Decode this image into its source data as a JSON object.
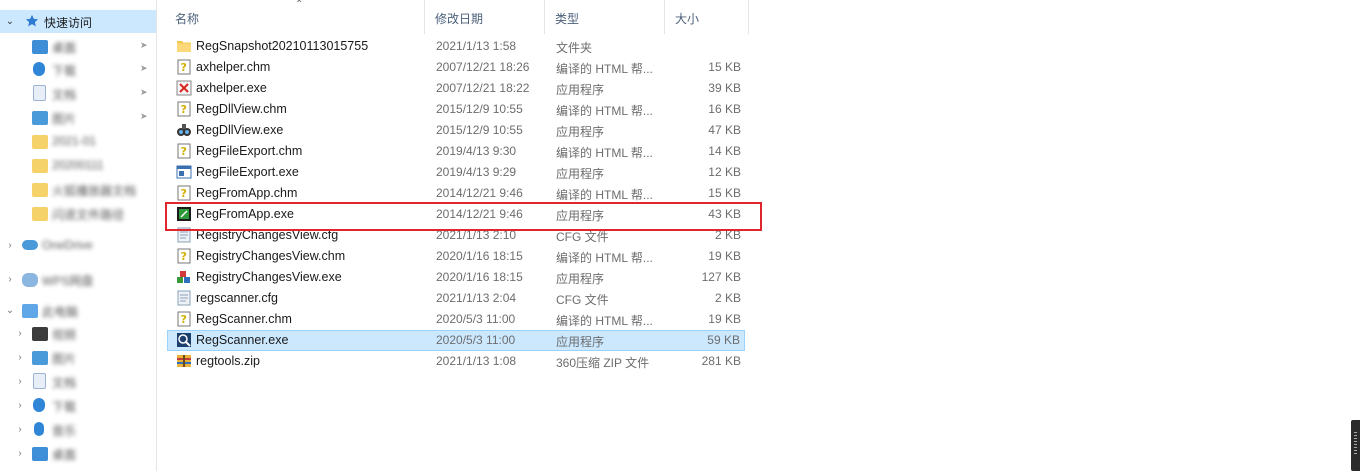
{
  "sidebar": {
    "quick_access_label": "快速访问",
    "quick_items": [
      "桌面",
      "下载",
      "文档",
      "图片",
      "2021-01",
      "20200111",
      "火狐播放器文档",
      "闪退文件路径"
    ],
    "onedrive_label": "OneDrive",
    "wps_label": "WPS网盘",
    "this_pc_label": "此电脑",
    "pc_items": [
      "视频",
      "图片",
      "文档",
      "下载",
      "音乐",
      "桌面"
    ]
  },
  "columns": {
    "name": "名称",
    "date": "修改日期",
    "type": "类型",
    "size": "大小"
  },
  "files": [
    {
      "name": "RegSnapshot20210113015755",
      "date": "2021/1/13 1:58",
      "type": "文件夹",
      "size": "",
      "icon": "folder-icon"
    },
    {
      "name": "axhelper.chm",
      "date": "2007/12/21 18:26",
      "type": "编译的 HTML 帮...",
      "size": "15 KB",
      "icon": "chm-help-icon"
    },
    {
      "name": "axhelper.exe",
      "date": "2007/12/21 18:22",
      "type": "应用程序",
      "size": "39 KB",
      "icon": "app-x-icon"
    },
    {
      "name": "RegDllView.chm",
      "date": "2015/12/9 10:55",
      "type": "编译的 HTML 帮...",
      "size": "16 KB",
      "icon": "chm-help-icon"
    },
    {
      "name": "RegDllView.exe",
      "date": "2015/12/9 10:55",
      "type": "应用程序",
      "size": "47 KB",
      "icon": "app-binoculars-icon"
    },
    {
      "name": "RegFileExport.chm",
      "date": "2019/4/13 9:30",
      "type": "编译的 HTML 帮...",
      "size": "14 KB",
      "icon": "chm-help-icon"
    },
    {
      "name": "RegFileExport.exe",
      "date": "2019/4/13 9:29",
      "type": "应用程序",
      "size": "12 KB",
      "icon": "app-window-icon"
    },
    {
      "name": "RegFromApp.chm",
      "date": "2014/12/21 9:46",
      "type": "编译的 HTML 帮...",
      "size": "15 KB",
      "icon": "chm-help-icon"
    },
    {
      "name": "RegFromApp.exe",
      "date": "2014/12/21 9:46",
      "type": "应用程序",
      "size": "43 KB",
      "icon": "app-green-icon"
    },
    {
      "name": "RegistryChangesView.cfg",
      "date": "2021/1/13 2:10",
      "type": "CFG 文件",
      "size": "2 KB",
      "icon": "cfg-file-icon"
    },
    {
      "name": "RegistryChangesView.chm",
      "date": "2020/1/16 18:15",
      "type": "编译的 HTML 帮...",
      "size": "19 KB",
      "icon": "chm-help-icon"
    },
    {
      "name": "RegistryChangesView.exe",
      "date": "2020/1/16 18:15",
      "type": "应用程序",
      "size": "127 KB",
      "icon": "app-cubes-icon"
    },
    {
      "name": "regscanner.cfg",
      "date": "2021/1/13 2:04",
      "type": "CFG 文件",
      "size": "2 KB",
      "icon": "cfg-file-icon"
    },
    {
      "name": "RegScanner.chm",
      "date": "2020/5/3 11:00",
      "type": "编译的 HTML 帮...",
      "size": "19 KB",
      "icon": "chm-help-icon"
    },
    {
      "name": "RegScanner.exe",
      "date": "2020/5/3 11:00",
      "type": "应用程序",
      "size": "59 KB",
      "icon": "app-scanner-icon"
    },
    {
      "name": "regtools.zip",
      "date": "2021/1/13 1:08",
      "type": "360压缩 ZIP 文件",
      "size": "281 KB",
      "icon": "zip-archive-icon"
    }
  ],
  "selected_file": "RegScanner.exe",
  "highlighted_file": "RegFromApp.exe",
  "colors": {
    "selection": "#cce8ff",
    "highlight_border": "#e0262c",
    "header_text": "#4c607a"
  }
}
